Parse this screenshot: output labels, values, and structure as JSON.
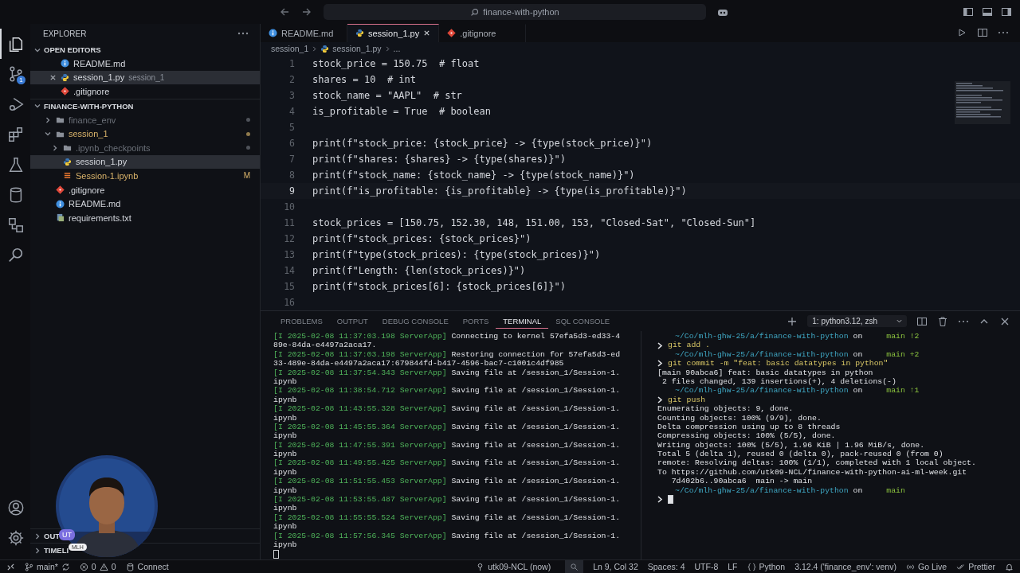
{
  "title_bar": {
    "search": "finance-with-python"
  },
  "activity_bar": {
    "items": [
      {
        "kind": "files",
        "selected": true
      },
      {
        "kind": "source-control",
        "selected": false,
        "badge": "1"
      },
      {
        "kind": "run",
        "selected": false
      },
      {
        "kind": "extensions",
        "selected": false
      },
      {
        "kind": "testing",
        "selected": false
      },
      {
        "kind": "database",
        "selected": false
      },
      {
        "kind": "remote",
        "selected": false
      },
      {
        "kind": "search",
        "selected": false
      }
    ],
    "bottom": [
      {
        "kind": "account"
      },
      {
        "kind": "settings"
      }
    ]
  },
  "explorer": {
    "title": "EXPLORER",
    "open_editors": {
      "title": "OPEN EDITORS",
      "items": [
        {
          "name": "README.md",
          "kind": "markdown",
          "selected": false
        },
        {
          "name": "session_1.py",
          "kind": "python",
          "detail": "session_1",
          "selected": true
        },
        {
          "name": ".gitignore",
          "kind": "git",
          "selected": false
        }
      ]
    },
    "project": {
      "title": "FINANCE-WITH-PYTHON",
      "children": [
        {
          "name": "finance_env",
          "kind": "folder",
          "expanded": false,
          "selected": false,
          "ignored": true,
          "modified": false
        },
        {
          "name": "session_1",
          "kind": "folder",
          "expanded": true,
          "selected": false,
          "ignored": false,
          "modified": true,
          "children": [
            {
              "name": ".ipynb_checkpoints",
              "kind": "folder",
              "expanded": false,
              "selected": false,
              "ignored": true,
              "modified": false
            },
            {
              "name": "session_1.py",
              "kind": "python",
              "selected": true,
              "ignored": false,
              "modified": false
            },
            {
              "name": "Session-1.ipynb",
              "kind": "notebook",
              "selected": false,
              "ignored": false,
              "modified": true,
              "badge": "M"
            }
          ]
        },
        {
          "name": ".gitignore",
          "kind": "git",
          "selected": false,
          "ignored": false,
          "modified": false
        },
        {
          "name": "README.md",
          "kind": "markdown",
          "selected": false,
          "ignored": false,
          "modified": false
        },
        {
          "name": "requirements.txt",
          "kind": "text",
          "selected": false,
          "ignored": false,
          "modified": false
        }
      ]
    },
    "outline": "OUT",
    "timeline": "TIMELI"
  },
  "editor": {
    "tabs": [
      {
        "label": "README.md",
        "kind": "markdown",
        "selected": false
      },
      {
        "label": "session_1.py",
        "kind": "python",
        "selected": true
      },
      {
        "label": ".gitignore",
        "kind": "git",
        "selected": false
      }
    ],
    "breadcrumb": [
      "session_1",
      "session_1.py",
      "..."
    ],
    "lines": [
      {
        "number": "1",
        "text": "stock_price = 150.75  # float",
        "current": false
      },
      {
        "number": "2",
        "text": "shares = 10  # int",
        "current": false
      },
      {
        "number": "3",
        "text": "stock_name = \"AAPL\"  # str",
        "current": false
      },
      {
        "number": "4",
        "text": "is_profitable = True  # boolean",
        "current": false
      },
      {
        "number": "5",
        "current": false
      },
      {
        "number": "6",
        "text": "print(f\"stock_price: {stock_price} -> {type(stock_price)}\")",
        "current": false
      },
      {
        "number": "7",
        "text": "print(f\"shares: {shares} -> {type(shares)}\")",
        "current": false
      },
      {
        "number": "8",
        "text": "print(f\"stock_name: {stock_name} -> {type(stock_name)}\")",
        "current": false
      },
      {
        "number": "9",
        "text": "print(f\"is_profitable: {is_profitable} -> {type(is_profitable)}\")",
        "current": true
      },
      {
        "number": "10",
        "current": false
      },
      {
        "number": "11",
        "text": "stock_prices = [150.75, 152.30, 148, 151.00, 153, \"Closed-Sat\", \"Closed-Sun\"]",
        "current": false
      },
      {
        "number": "12",
        "text": "print(f\"stock_prices: {stock_prices}\")",
        "current": false
      },
      {
        "number": "13",
        "text": "print(f\"type(stock_prices): {type(stock_prices)}\")",
        "current": false
      },
      {
        "number": "14",
        "text": "print(f\"Length: {len(stock_prices)}\")",
        "current": false
      },
      {
        "number": "15",
        "text": "print(f\"stock_prices[6]: {stock_prices[6]}\")",
        "current": false
      },
      {
        "number": "16",
        "current": false
      }
    ]
  },
  "panel": {
    "tabs": [
      {
        "label": "PROBLEMS",
        "selected": false
      },
      {
        "label": "OUTPUT",
        "selected": false
      },
      {
        "label": "DEBUG CONSOLE",
        "selected": false
      },
      {
        "label": "PORTS",
        "selected": false
      },
      {
        "label": "TERMINAL",
        "selected": true
      },
      {
        "label": "SQL CONSOLE",
        "selected": false
      }
    ],
    "terminal_picker": "1: python3.12, zsh",
    "left_terminal": [
      {
        "kind": "log",
        "prefix": "[I 2025-02-08 11:37:03.198 ServerApp]",
        "text": "Connecting to kernel 57efa5d3-ed33-4"
      },
      {
        "kind": "plain",
        "text": "89e-84da-e4497a2aca17."
      },
      {
        "kind": "log",
        "prefix": "[I 2025-02-08 11:37:03.198 ServerApp]",
        "text": "Restoring connection for 57efa5d3-ed"
      },
      {
        "kind": "plain",
        "text": "33-489e-84da-e4497a2aca17:679844fd-b417-4596-bac7-c1001c4df985"
      },
      {
        "kind": "log",
        "prefix": "[I 2025-02-08 11:37:54.343 ServerApp]",
        "text": "Saving file at /session_1/Session-1."
      },
      {
        "kind": "plain",
        "text": "ipynb"
      },
      {
        "kind": "log",
        "prefix": "[I 2025-02-08 11:38:54.712 ServerApp]",
        "text": "Saving file at /session_1/Session-1."
      },
      {
        "kind": "plain",
        "text": "ipynb"
      },
      {
        "kind": "log",
        "prefix": "[I 2025-02-08 11:43:55.328 ServerApp]",
        "text": "Saving file at /session_1/Session-1."
      },
      {
        "kind": "plain",
        "text": "ipynb"
      },
      {
        "kind": "log",
        "prefix": "[I 2025-02-08 11:45:55.364 ServerApp]",
        "text": "Saving file at /session_1/Session-1."
      },
      {
        "kind": "plain",
        "text": "ipynb"
      },
      {
        "kind": "log",
        "prefix": "[I 2025-02-08 11:47:55.391 ServerApp]",
        "text": "Saving file at /session_1/Session-1."
      },
      {
        "kind": "plain",
        "text": "ipynb"
      },
      {
        "kind": "log",
        "prefix": "[I 2025-02-08 11:49:55.425 ServerApp]",
        "text": "Saving file at /session_1/Session-1."
      },
      {
        "kind": "plain",
        "text": "ipynb"
      },
      {
        "kind": "log",
        "prefix": "[I 2025-02-08 11:51:55.453 ServerApp]",
        "text": "Saving file at /session_1/Session-1."
      },
      {
        "kind": "plain",
        "text": "ipynb"
      },
      {
        "kind": "log",
        "prefix": "[I 2025-02-08 11:53:55.487 ServerApp]",
        "text": "Saving file at /session_1/Session-1."
      },
      {
        "kind": "plain",
        "text": "ipynb"
      },
      {
        "kind": "log",
        "prefix": "[I 2025-02-08 11:55:55.524 ServerApp]",
        "text": "Saving file at /session_1/Session-1."
      },
      {
        "kind": "plain",
        "text": "ipynb"
      },
      {
        "kind": "log",
        "prefix": "[I 2025-02-08 11:57:56.345 ServerApp]",
        "text": "Saving file at /session_1/Session-1."
      },
      {
        "kind": "plain",
        "text": "ipynb"
      },
      {
        "kind": "cursor"
      }
    ],
    "right_terminal": [
      {
        "kind": "prompt",
        "path": "~/Co/mlh-ghw-25/a/finance-with-python",
        "on": "on",
        "branch": "main !2"
      },
      {
        "kind": "command",
        "text": "git add ."
      },
      {
        "kind": "prompt",
        "path": "~/Co/mlh-ghw-25/a/finance-with-python",
        "on": "on",
        "branch": "main +2"
      },
      {
        "kind": "command",
        "text": "git commit -m \"feat: basic datatypes in python\""
      },
      {
        "kind": "output",
        "text": "[main 90abca6] feat: basic datatypes in python"
      },
      {
        "kind": "output",
        "text": " 2 files changed, 139 insertions(+), 4 deletions(-)"
      },
      {
        "kind": "prompt",
        "path": "~/Co/mlh-ghw-25/a/finance-with-python",
        "on": "on",
        "branch": "main ↑1"
      },
      {
        "kind": "command",
        "text": "git push"
      },
      {
        "kind": "output",
        "text": "Enumerating objects: 9, done."
      },
      {
        "kind": "output",
        "text": "Counting objects: 100% (9/9), done."
      },
      {
        "kind": "output",
        "text": "Delta compression using up to 8 threads"
      },
      {
        "kind": "output",
        "text": "Compressing objects: 100% (5/5), done."
      },
      {
        "kind": "output",
        "text": "Writing objects: 100% (5/5), 1.96 KiB | 1.96 MiB/s, done."
      },
      {
        "kind": "output",
        "text": "Total 5 (delta 1), reused 0 (delta 0), pack-reused 0 (from 0)"
      },
      {
        "kind": "output",
        "text": "remote: Resolving deltas: 100% (1/1), completed with 1 local object."
      },
      {
        "kind": "output",
        "text": "To https://github.com/utk09-NCL/finance-with-python-ai-ml-week.git"
      },
      {
        "kind": "output",
        "text": "   7d402b6..90abca6  main -> main"
      },
      {
        "kind": "prompt",
        "path": "~/Co/mlh-ghw-25/a/finance-with-python",
        "on": "on",
        "branch": "main"
      },
      {
        "kind": "input"
      }
    ]
  },
  "overlay": {
    "kind": "picture",
    "badge": "UT",
    "tag": "MLH"
  },
  "status_bar": {
    "left": [
      {
        "kind": "remote"
      },
      {
        "kind": "branch",
        "text": "main*"
      },
      {
        "kind": "errors",
        "text": "0"
      },
      {
        "kind": "warnings",
        "text": "0"
      },
      {
        "kind": "connect",
        "text": "Connect"
      }
    ],
    "right": [
      {
        "kind": "account",
        "text": "utk09-NCL (now)"
      },
      {
        "kind": "zoom"
      },
      {
        "kind": "text",
        "text": "Ln 9, Col 32"
      },
      {
        "kind": "text",
        "text": "Spaces: 4"
      },
      {
        "kind": "text",
        "text": "UTF-8"
      },
      {
        "kind": "text",
        "text": "LF"
      },
      {
        "kind": "language",
        "text": "Python"
      },
      {
        "kind": "text",
        "text": "3.12.4 ('finance_env': venv)"
      },
      {
        "kind": "live",
        "text": "Go Live"
      },
      {
        "kind": "prettier",
        "text": "Prettier"
      },
      {
        "kind": "bell"
      }
    ]
  }
}
